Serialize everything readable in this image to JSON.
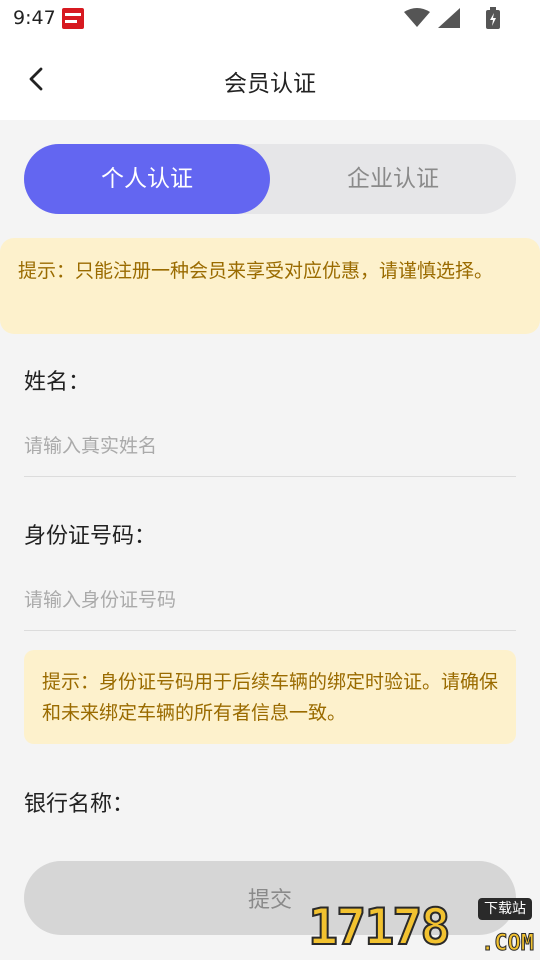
{
  "status_bar": {
    "time": "9:47",
    "icons": [
      "app-badge-icon",
      "wifi-icon",
      "signal-icon",
      "battery-icon"
    ]
  },
  "header": {
    "title": "会员认证",
    "back_icon": "chevron-left-icon"
  },
  "tabs": [
    {
      "label": "个人认证",
      "active": true
    },
    {
      "label": "企业认证",
      "active": false
    }
  ],
  "notice_top": "提示：只能注册一种会员来享受对应优惠，请谨慎选择。",
  "form": {
    "name": {
      "label": "姓名：",
      "placeholder": "请输入真实姓名",
      "value": ""
    },
    "id_number": {
      "label": "身份证号码：",
      "placeholder": "请输入身份证号码",
      "value": ""
    },
    "id_notice": "提示：身份证号码用于后续车辆的绑定时验证。请确保和未来绑定车辆的所有者信息一致。",
    "bank": {
      "label": "银行名称："
    }
  },
  "submit_label": "提交",
  "watermark": {
    "number": "17178",
    "badge": "下载站",
    "domain": ".COM"
  },
  "colors": {
    "accent": "#6366f1",
    "notice_bg": "#fdf1cc",
    "notice_text": "#9a6b00",
    "page_bg": "#f4f4f4",
    "button_disabled": "#d6d6d6"
  }
}
